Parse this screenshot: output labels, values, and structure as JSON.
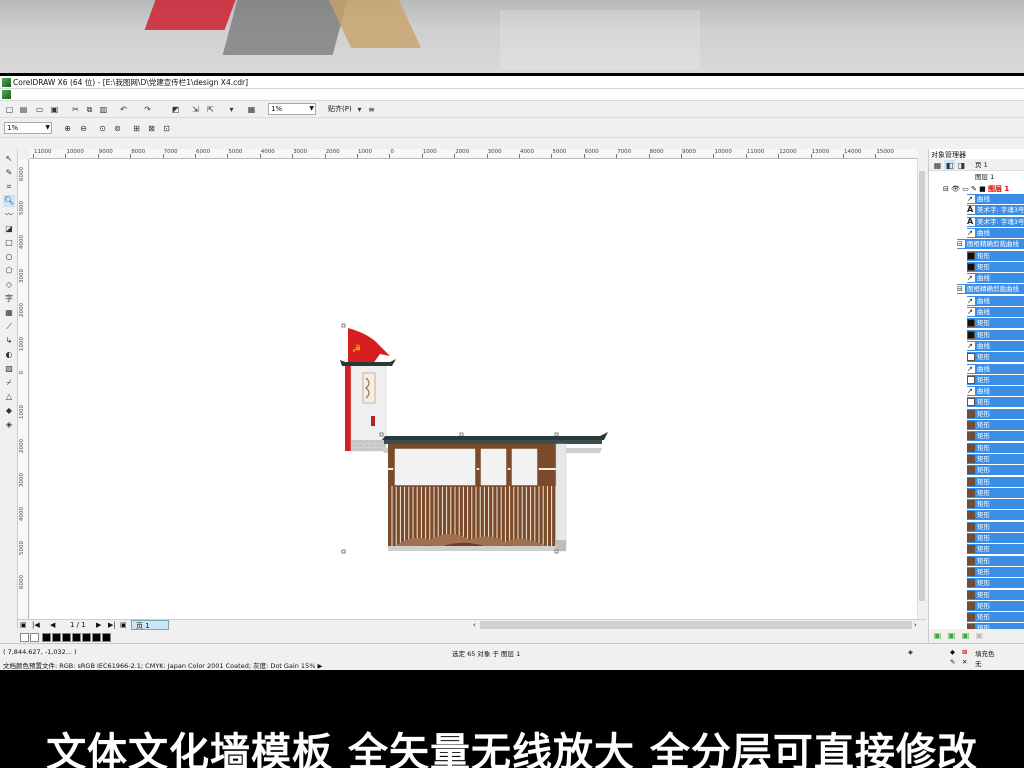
{
  "window": {
    "title": "CorelDRAW X6 (64 位) - [E:\\我图网\\D\\党建宣传栏1\\design X4.cdr]"
  },
  "toolbar": {
    "zoom_value": "1%",
    "snap_label": "贴齐(P)",
    "font_size_value": "1%"
  },
  "ruler": {
    "h_labels": [
      "11000",
      "10000",
      "9000",
      "8000",
      "7000",
      "6000",
      "5000",
      "4000",
      "3000",
      "2000",
      "1000",
      "0",
      "1000",
      "2000",
      "3000",
      "4000",
      "5000",
      "6000",
      "7000",
      "8000",
      "9000",
      "10000",
      "11000",
      "12000",
      "13000",
      "14000",
      "15000"
    ],
    "v_labels": [
      "6000",
      "5000",
      "4000",
      "3000",
      "2000",
      "1000",
      "0",
      "1000",
      "2000",
      "3000",
      "4000",
      "5000",
      "6000"
    ]
  },
  "page_nav": {
    "counter": "1 / 1",
    "page_tab": "页 1"
  },
  "status": {
    "coords": "( 7,844.627, -1,032... )",
    "selection": "选定 65 对象 于 图层 1",
    "color_profile": "文档颜色预置文件: RGB: sRGB IEC61966-2.1; CMYK: Japan Color 2001 Coated; 灰度: Dot Gain 15% ▶",
    "fill_label": "填充色",
    "outline_label": "无"
  },
  "docker": {
    "title": "对象管理器",
    "page_label": "页 1",
    "layer_label": "图层 1",
    "layer_top": "图层 1",
    "rows": [
      {
        "label": "曲线",
        "kind": "curve",
        "hl": true
      },
      {
        "label": "美术字: 字魂3号",
        "kind": "text",
        "hl": true
      },
      {
        "label": "美术字: 字魂3号",
        "kind": "text",
        "hl": true
      },
      {
        "label": "曲线",
        "kind": "curve",
        "hl": true
      },
      {
        "label": "图框精确剪裁曲线",
        "kind": "group",
        "hl": true
      },
      {
        "label": "矩形",
        "kind": "black",
        "hl": true
      },
      {
        "label": "矩形",
        "kind": "black",
        "hl": true
      },
      {
        "label": "曲线",
        "kind": "curve",
        "hl": true
      },
      {
        "label": "图框精确剪裁曲线",
        "kind": "group",
        "hl": true
      },
      {
        "label": "曲线",
        "kind": "curve",
        "hl": true
      },
      {
        "label": "曲线",
        "kind": "curve",
        "hl": true
      },
      {
        "label": "矩形",
        "kind": "black",
        "hl": true
      },
      {
        "label": "矩形",
        "kind": "black",
        "hl": true
      },
      {
        "label": "曲线",
        "kind": "curve",
        "hl": true
      },
      {
        "label": "矩形",
        "kind": "white",
        "hl": true
      },
      {
        "label": "曲线",
        "kind": "curve",
        "hl": true
      },
      {
        "label": "矩形",
        "kind": "white",
        "hl": true
      },
      {
        "label": "曲线",
        "kind": "curve",
        "hl": true
      },
      {
        "label": "矩形",
        "kind": "white",
        "hl": true
      },
      {
        "label": "矩形",
        "kind": "brown",
        "hl": true
      },
      {
        "label": "矩形",
        "kind": "brown",
        "hl": true
      },
      {
        "label": "矩形",
        "kind": "brown",
        "hl": true
      },
      {
        "label": "矩形",
        "kind": "brown",
        "hl": true
      },
      {
        "label": "矩形",
        "kind": "brown",
        "hl": true
      },
      {
        "label": "矩形",
        "kind": "brown",
        "hl": true
      },
      {
        "label": "矩形",
        "kind": "brown",
        "hl": true
      },
      {
        "label": "矩形",
        "kind": "brown",
        "hl": true
      },
      {
        "label": "矩形",
        "kind": "brown",
        "hl": true
      },
      {
        "label": "矩形",
        "kind": "brown",
        "hl": true
      },
      {
        "label": "矩形",
        "kind": "brown",
        "hl": true
      },
      {
        "label": "矩形",
        "kind": "brown",
        "hl": true
      },
      {
        "label": "矩形",
        "kind": "brown",
        "hl": true
      },
      {
        "label": "矩形",
        "kind": "brown",
        "hl": true
      },
      {
        "label": "矩形",
        "kind": "brown",
        "hl": true
      },
      {
        "label": "矩形",
        "kind": "brown",
        "hl": true
      },
      {
        "label": "矩形",
        "kind": "brown",
        "hl": true
      },
      {
        "label": "矩形",
        "kind": "brown",
        "hl": true
      },
      {
        "label": "矩形",
        "kind": "brown",
        "hl": true
      },
      {
        "label": "矩形",
        "kind": "brown",
        "hl": true
      }
    ]
  },
  "caption": "文体文化墙模板  全矢量无线放大 全分层可直接修改",
  "colors": {
    "selection": "#3a8ee6",
    "flag_red": "#d61f1f",
    "wood_brown": "#7a4a2a",
    "hill_brown": "#a07050"
  }
}
